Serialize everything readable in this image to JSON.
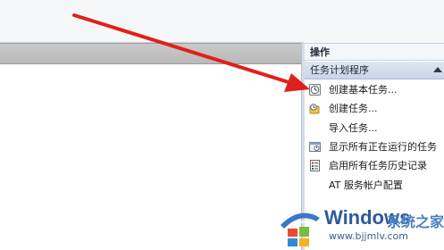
{
  "actions_pane": {
    "title": "操作",
    "section_header": "任务计划程序",
    "items": [
      {
        "label": "创建基本任务...",
        "icon": "clock-icon"
      },
      {
        "label": "创建任务...",
        "icon": "task-folder-icon"
      },
      {
        "label": "导入任务...",
        "icon": "none"
      },
      {
        "label": "显示所有正在运行的任务",
        "icon": "running-tasks-icon"
      },
      {
        "label": "启用所有任务历史记录",
        "icon": "history-icon"
      },
      {
        "label": "AT 服务帐户配置",
        "icon": "none"
      }
    ]
  },
  "annotation": {
    "arrow_color": "#e0201c"
  },
  "watermark": {
    "brand_en": "Windows",
    "brand_cn": "系统之家",
    "url": "www.bjjmlv.com"
  }
}
